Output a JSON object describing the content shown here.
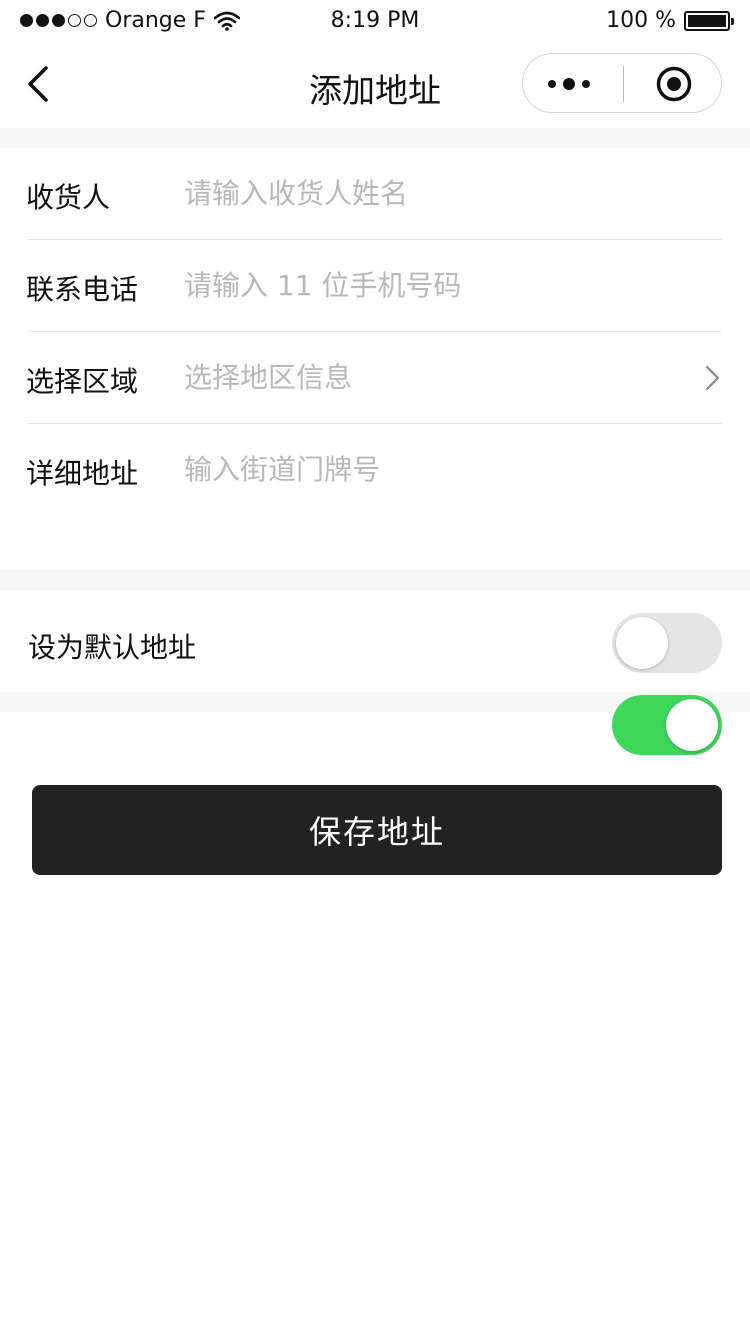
{
  "status_bar": {
    "carrier": "Orange F",
    "time": "8:19 PM",
    "battery": "100 %"
  },
  "nav": {
    "title": "添加地址",
    "back_icon": "chevron-left-icon",
    "more_icon": "more-dots-icon",
    "close_icon": "target-circle-icon"
  },
  "form": {
    "rows": [
      {
        "label": "收货人",
        "placeholder": "请输入收货人姓名",
        "value": ""
      },
      {
        "label": "联系电话",
        "placeholder": "请输入 11 位手机号码",
        "value": ""
      },
      {
        "label": "选择区域",
        "placeholder": "选择地区信息",
        "value": ""
      },
      {
        "label": "详细地址",
        "placeholder": "输入街道门牌号",
        "value": ""
      }
    ]
  },
  "default_address": {
    "label": "设为默认地址",
    "toggle_off_state": false,
    "toggle_on_state": true
  },
  "save_button": {
    "label": "保存地址"
  },
  "colors": {
    "toggle_on": "#3ed65b",
    "toggle_off": "#e5e5e5",
    "button_bg": "#222222",
    "placeholder": "#b8b8b8",
    "separator": "#f7f7f7"
  }
}
